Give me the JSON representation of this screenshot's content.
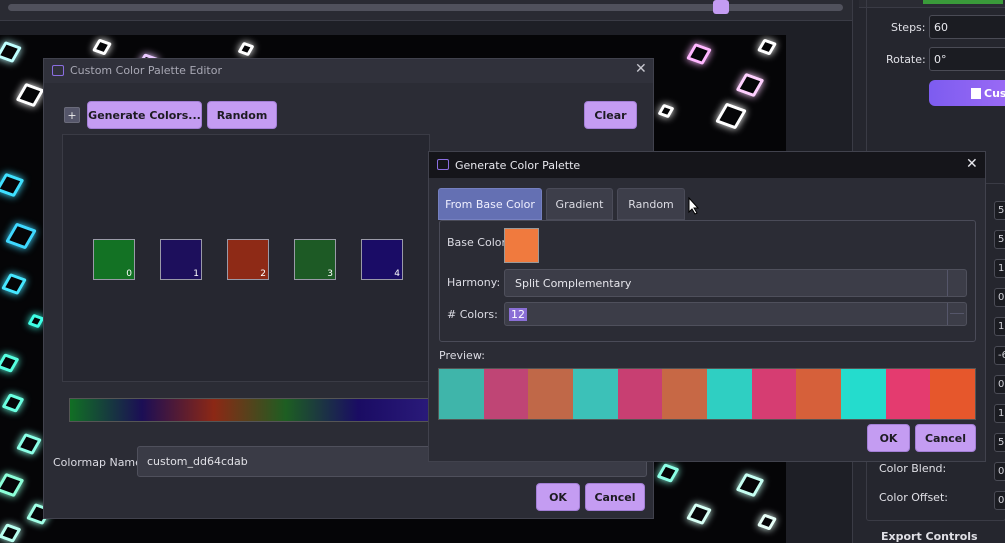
{
  "top_slider": {
    "value_fraction": 0.86
  },
  "right_panel": {
    "steps_label": "Steps:",
    "steps_value": "60",
    "rotate_label": "Rotate:",
    "rotate_value": "0°",
    "custom_button_label": "Cus",
    "small_values": [
      "5.",
      "50",
      "1.",
      "0.",
      "1.",
      "-6",
      "0",
      "1.",
      "5",
      "0.",
      "0."
    ],
    "color_blend_label": "Color Blend:",
    "color_offset_label": "Color Offset:",
    "export_controls_label": "Export Controls"
  },
  "editor_dialog": {
    "title": "Custom Color Palette Editor",
    "add_label": "+",
    "generate_button": "Generate Colors...",
    "random_button": "Random",
    "clear_button": "Clear",
    "swatches": [
      {
        "index": "0",
        "color": "#137224"
      },
      {
        "index": "1",
        "color": "#1d0f5c"
      },
      {
        "index": "2",
        "color": "#8e2a16"
      },
      {
        "index": "3",
        "color": "#1d5a25"
      },
      {
        "index": "4",
        "color": "#1a0c66"
      }
    ],
    "colormap_name_label": "Colormap Name:",
    "colormap_name_value": "custom_dd64cdab",
    "ok_button": "OK",
    "cancel_button": "Cancel"
  },
  "generate_dialog": {
    "title": "Generate Color Palette",
    "tabs": [
      "From Base Color",
      "Gradient",
      "Random"
    ],
    "active_tab": "From Base Color",
    "base_color_label": "Base Color:",
    "base_color": "#f07a3e",
    "harmony_label": "Harmony:",
    "harmony_value": "Split Complementary",
    "num_colors_label": "# Colors:",
    "num_colors_value": "12",
    "preview_label": "Preview:",
    "preview_colors": [
      "#3fb5aa",
      "#bf4575",
      "#c06848",
      "#3cc1b8",
      "#c83f72",
      "#c76845",
      "#2fcfc2",
      "#d63d72",
      "#d6603a",
      "#24dccd",
      "#e43b6f",
      "#e6572c"
    ],
    "ok_button": "OK",
    "cancel_button": "Cancel"
  },
  "colors": {
    "accent": "#c49cf2",
    "active_tab": "#6470b3",
    "panel_bg": "#2b2c35"
  }
}
